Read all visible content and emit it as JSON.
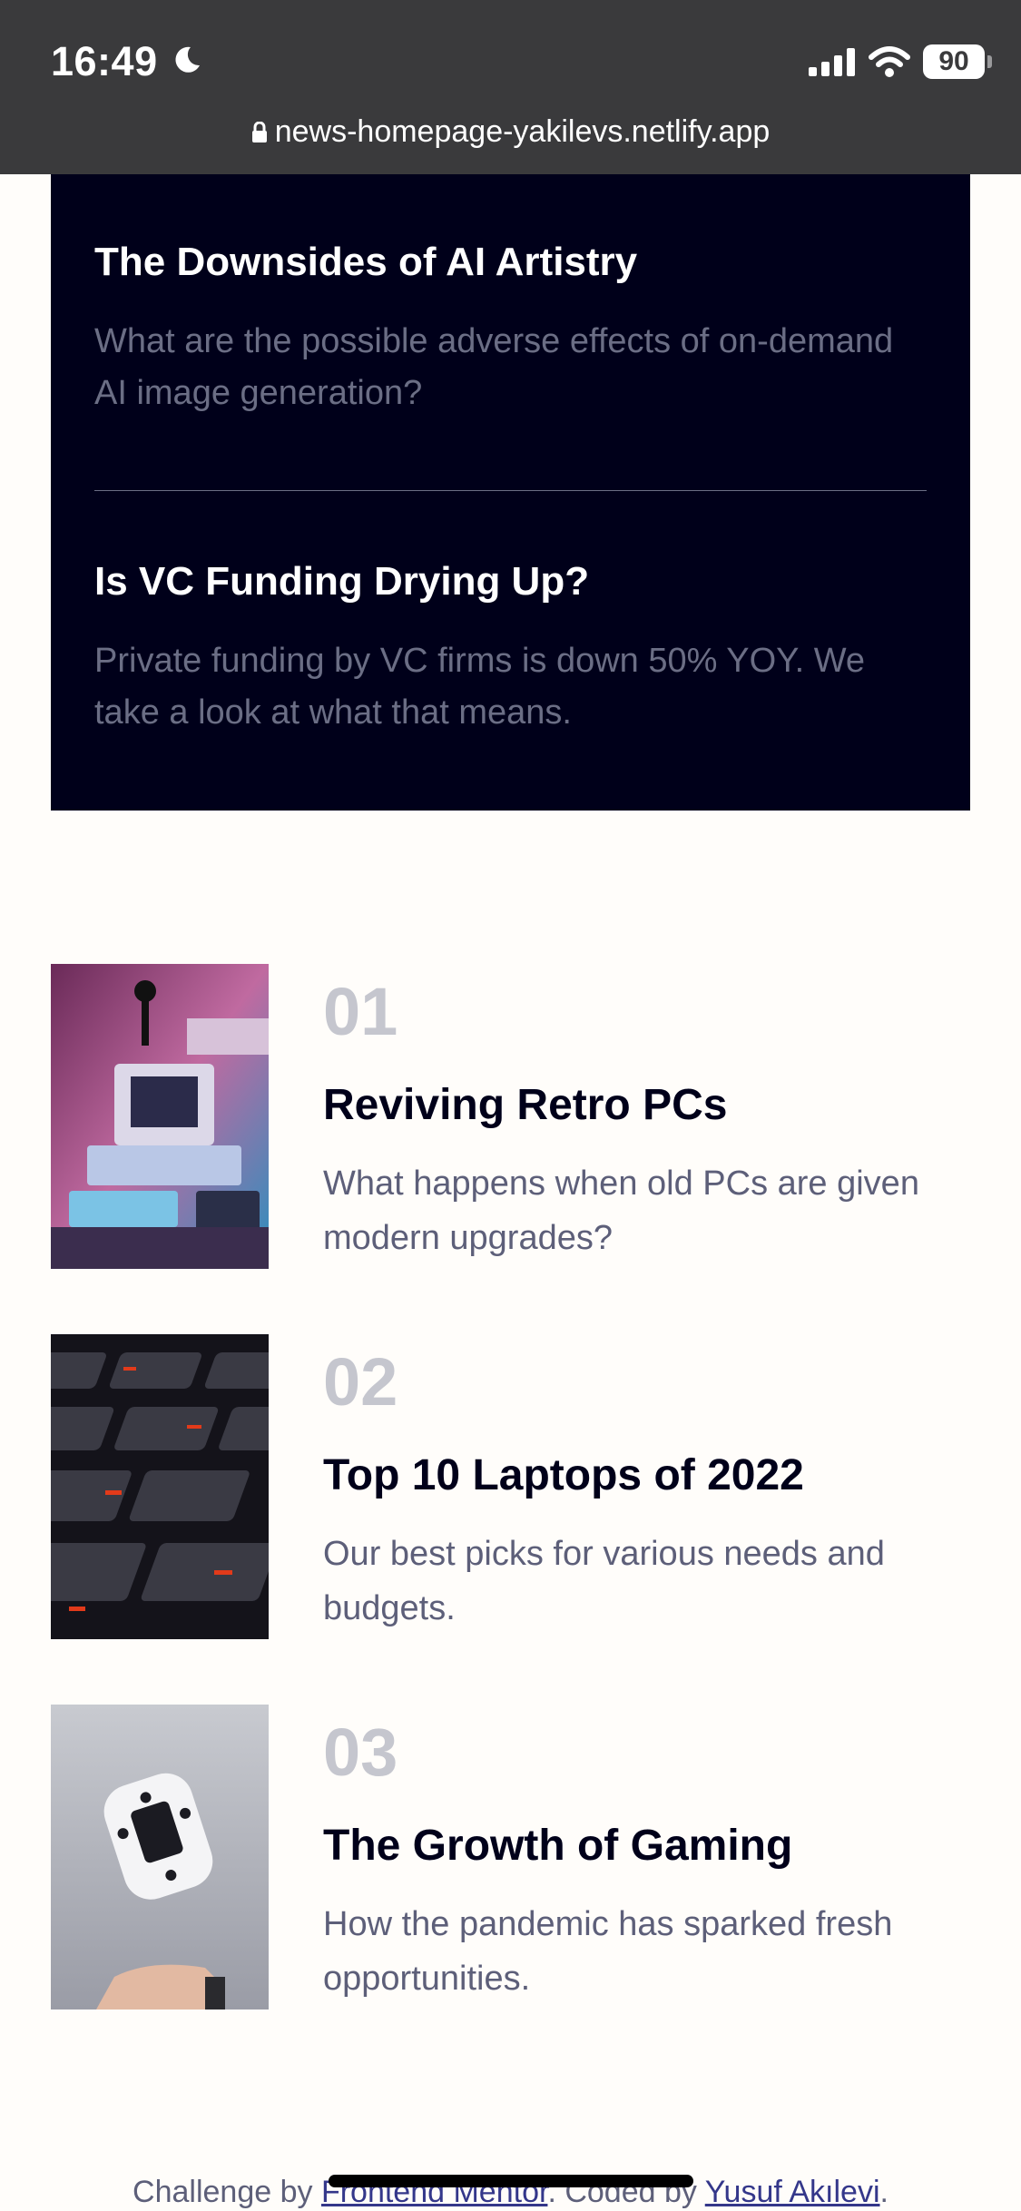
{
  "status": {
    "time": "16:49",
    "battery": "90",
    "url": "news-homepage-yakilevs.netlify.app"
  },
  "new_panel": {
    "items": [
      {
        "title": "The Downsides of AI Artistry",
        "description": "What are the possible adverse effects of on-demand AI image generation?"
      },
      {
        "title": "Is VC Funding Drying Up?",
        "description": "Private funding by VC firms is down 50% YOY. We take a look at what that means."
      }
    ]
  },
  "articles": [
    {
      "number": "01",
      "title": "Reviving Retro PCs",
      "description": "What happens when old PCs are given modern upgrades?",
      "image": "retro-pcs-image"
    },
    {
      "number": "02",
      "title": "Top 10 Laptops of 2022",
      "description": "Our best picks for various needs and budgets.",
      "image": "laptop-keyboard-image"
    },
    {
      "number": "03",
      "title": "The Growth of Gaming",
      "description": "How the pandemic has sparked fresh opportunities.",
      "image": "gamepad-image"
    }
  ],
  "footer": {
    "prefix": "Challenge by",
    "challenge_link": "Frontend Mentor",
    "middle": ". Coded by",
    "author_link": "Yusuf Akılevi",
    "suffix": "."
  },
  "colors": {
    "background": "#fffdfa",
    "dark_panel": "#00001a",
    "muted_text": "#6b6e85",
    "number_gray": "#c5c6ce"
  }
}
